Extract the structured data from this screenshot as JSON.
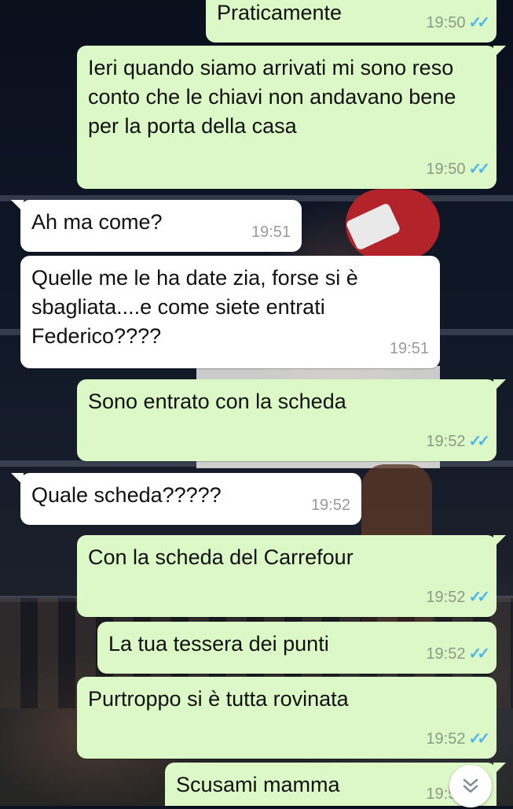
{
  "messages": [
    {
      "dir": "out",
      "text": "Praticamente",
      "time": "19:50"
    },
    {
      "dir": "out",
      "text": "Ieri quando siamo arrivati mi sono reso conto che le chiavi non andavano bene per la porta della casa",
      "time": "19:50"
    },
    {
      "dir": "in",
      "text": "Ah ma come?",
      "time": "19:51"
    },
    {
      "dir": "in",
      "text": "Quelle me le ha date zia, forse si è sbagliata....e come siete entrati Federico????",
      "time": "19:51"
    },
    {
      "dir": "out",
      "text": "Sono entrato con la scheda",
      "time": "19:52"
    },
    {
      "dir": "in",
      "text": "Quale scheda?????",
      "time": "19:52"
    },
    {
      "dir": "out",
      "text": "Con la scheda del Carrefour",
      "time": "19:52"
    },
    {
      "dir": "out",
      "text": "La tua tessera dei punti",
      "time": "19:52"
    },
    {
      "dir": "out",
      "text": "Purtroppo si è tutta rovinata",
      "time": "19:52"
    },
    {
      "dir": "out",
      "text": "Scusami mamma",
      "time": "19:52"
    }
  ],
  "colors": {
    "outgoing_bubble": "#dcf8c6",
    "incoming_bubble": "#ffffff",
    "read_ticks": "#4fb6ec"
  },
  "icons": {
    "read_receipt": "double-check-icon",
    "scroll_down": "double-chevron-down-icon"
  }
}
